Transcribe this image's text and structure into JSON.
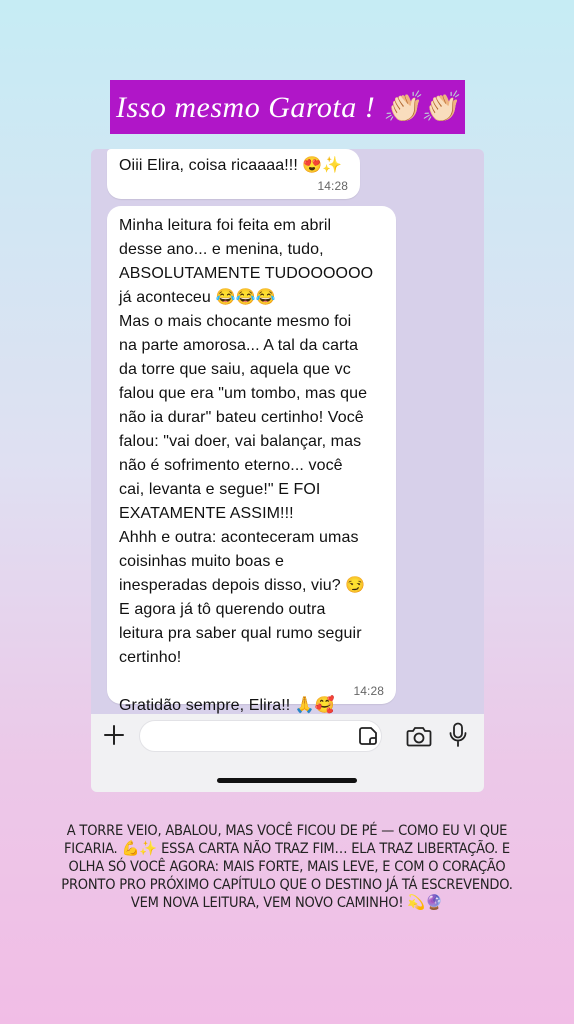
{
  "headline": "Isso mesmo Garota ! 👏🏻👏🏻",
  "chat": {
    "messages": [
      {
        "text": "Oiii Elira, coisa ricaaaa!!! 😍✨",
        "time": "14:28"
      },
      {
        "text": "Minha leitura foi feita em abril\ndesse ano... e menina, tudo,\nABSOLUTAMENTE TUDOOOOOO\njá aconteceu 😂😂😂\nMas o mais chocante mesmo foi\nna parte amorosa... A tal da carta\nda torre que saiu, aquela que vc\nfalou que era \"um tombo, mas que\nnão ia durar\" bateu certinho! Você\nfalou: \"vai doer, vai balançar, mas\nnão é sofrimento eterno... você\ncai, levanta e segue!\" E FOI\nEXATAMENTE ASSIM!!!\nAhhh e outra: aconteceram umas\ncoisinhas muito boas e\ninesperadas depois disso, viu? 😏\nE agora já tô querendo outra\nleitura pra saber qual rumo seguir\ncertinho!\n\nGratidão sempre, Elira!! 🙏🥰\nVocê é luz demais",
        "time": "14:28"
      }
    ]
  },
  "input_bar": {
    "icons": [
      "plus-icon",
      "sticker-icon",
      "camera-icon",
      "microphone-icon"
    ]
  },
  "caption": "A TORRE VEIO, ABALOU, MAS VOCÊ FICOU DE PÉ — COMO EU VI QUE FICARIA. 💪✨ ESSA CARTA NÃO TRAZ FIM… ELA TRAZ LIBERTAÇÃO. E OLHA SÓ VOCÊ AGORA: MAIS FORTE, MAIS LEVE, E COM O CORAÇÃO PRONTO PRO PRÓXIMO CAPÍTULO QUE O DESTINO JÁ TÁ ESCREVENDO. VEM NOVA LEITURA, VEM NOVO CAMINHO! 💫🔮",
  "colors": {
    "headline_bg": "#b016c8",
    "chat_bg": "#d7d0ea",
    "bubble_bg": "#ffffff"
  }
}
